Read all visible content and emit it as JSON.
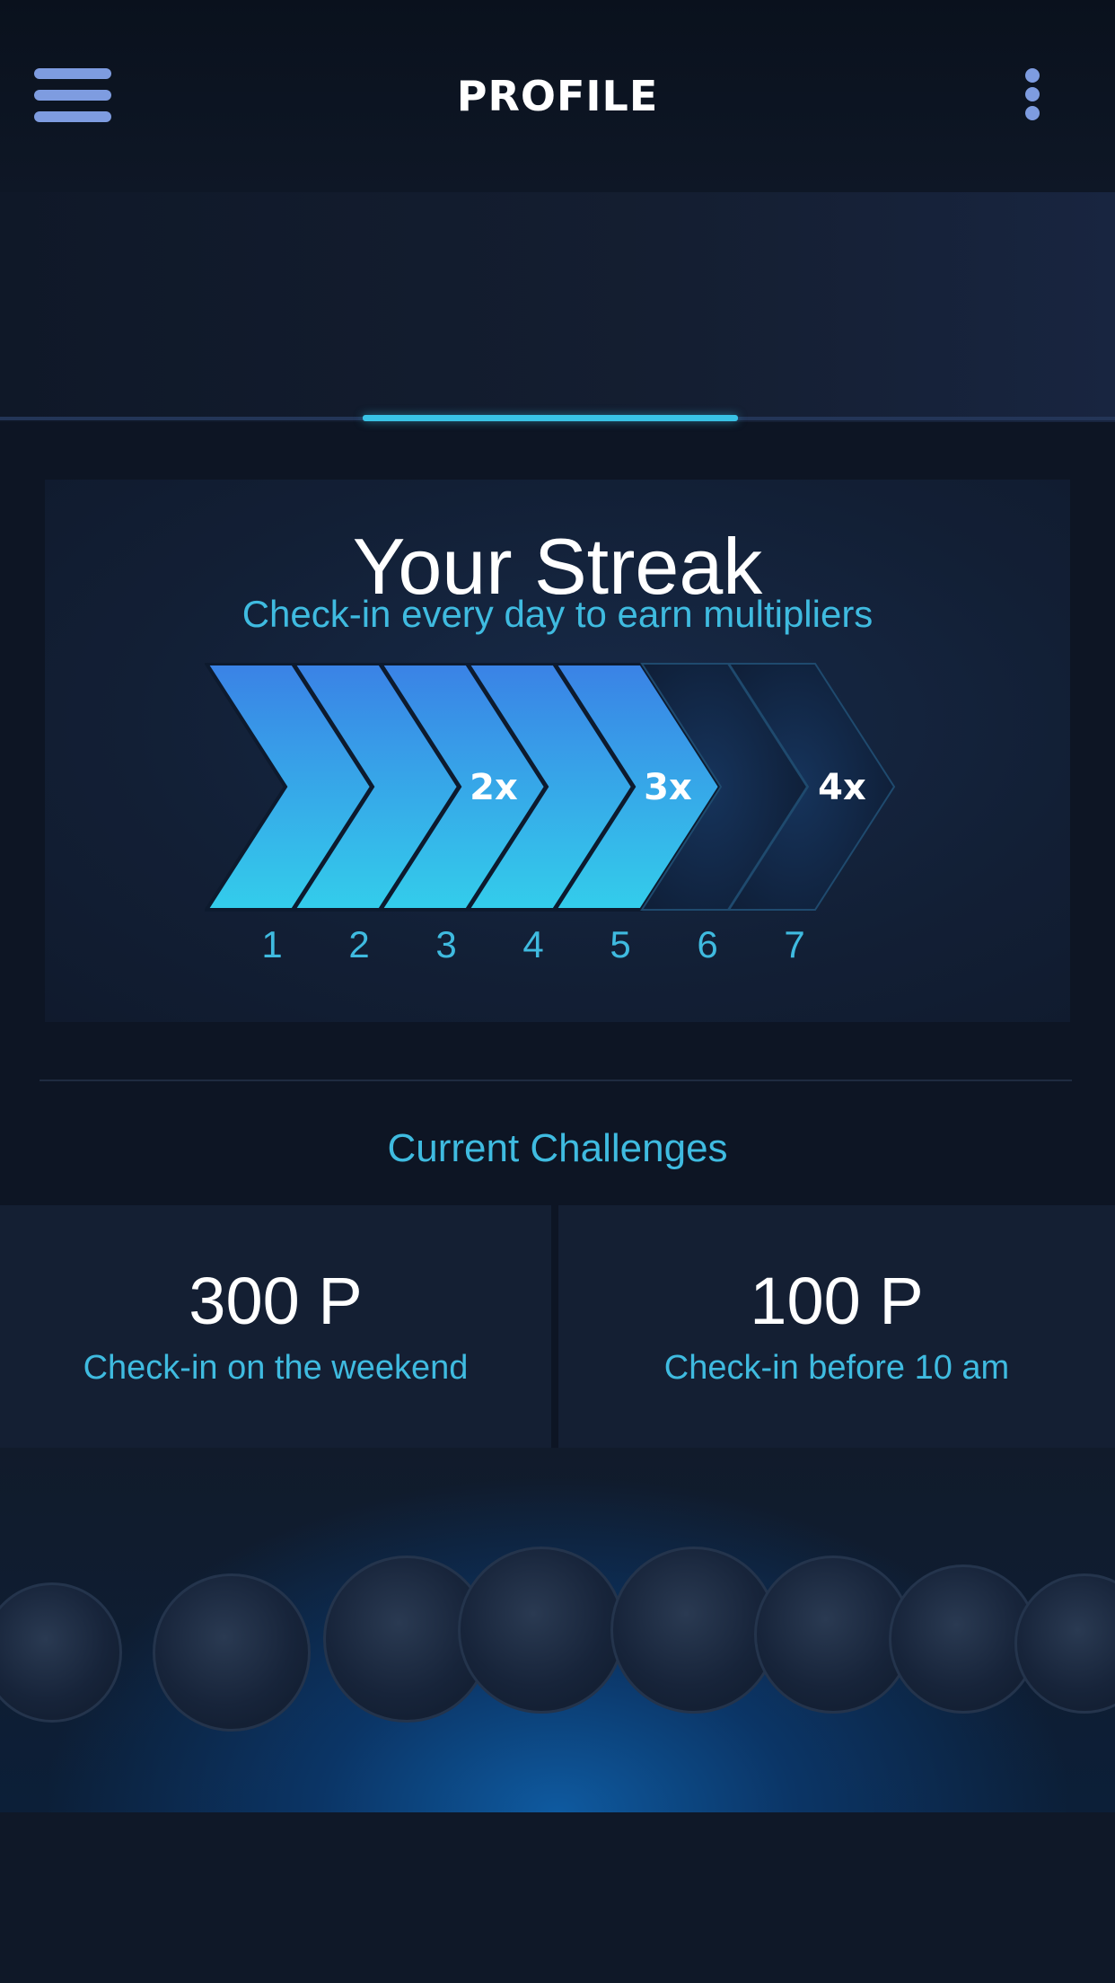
{
  "header": {
    "title": "PROFILE",
    "menu_icon": "hamburger-menu-icon",
    "more_icon": "kebab-more-icon"
  },
  "streak": {
    "title": "Your Streak",
    "subtitle": "Check-in every day to earn multipliers",
    "days": [
      "1",
      "2",
      "3",
      "4",
      "5",
      "6",
      "7"
    ],
    "completed_days": 5,
    "multipliers": [
      "2x",
      "3x",
      "4x"
    ]
  },
  "challenges": {
    "title": "Current Challenges",
    "items": [
      {
        "points": "300 P",
        "description": "Check-in on the weekend"
      },
      {
        "points": "100 P",
        "description": "Check-in before 10 am"
      }
    ]
  },
  "colors": {
    "accent": "#39c3e6",
    "icon": "#7e9ce0",
    "background": "#0d1524",
    "chevron_start": "#3a82e6",
    "chevron_end": "#33cdeb"
  }
}
